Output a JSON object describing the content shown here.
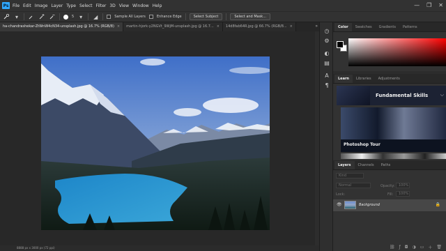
{
  "menu": [
    "File",
    "Edit",
    "Image",
    "Layer",
    "Type",
    "Select",
    "Filter",
    "3D",
    "View",
    "Window",
    "Help"
  ],
  "logo": "Ps",
  "window_controls": [
    "—",
    "❐",
    "✕"
  ],
  "options": {
    "brush_size": "5",
    "sample_all_layers": "Sample All Layers",
    "enhance_edge": "Enhance Edge",
    "select_subject": "Select Subject",
    "select_and_mask": "Select and Mask..."
  },
  "tabs": [
    {
      "label": "ha-chandrashekar-ZtWnW4cN34-unsplash.jpg @ 16.7% (RGB/8)",
      "active": true
    },
    {
      "label": "martin-hjork-y2NGVt_9WjM-unsplash.jpg @ 16.7...",
      "active": false
    },
    {
      "label": "14d8fab64R.jpg @ 66.7% (RGB/8...",
      "active": false
    }
  ],
  "tab_overflow": "»",
  "status": "8888 px x 3000 px (72 ppi)",
  "color_panel": {
    "tabs": [
      "Color",
      "Swatches",
      "Gradients",
      "Patterns"
    ]
  },
  "learn_panel": {
    "tabs": [
      "Learn",
      "Libraries",
      "Adjustments"
    ],
    "section_title": "Fundamental Skills",
    "tour_label": "Photoshop Tour"
  },
  "layers_panel": {
    "tabs": [
      "Layers",
      "Channels",
      "Paths"
    ],
    "kind": "Kind",
    "blend_mode": "Normal",
    "opacity_label": "Opacity:",
    "opacity_value": "100%",
    "lock_label": "Lock:",
    "fill_label": "Fill:",
    "fill_value": "100%",
    "layer_name": "Background"
  },
  "colors": {
    "accent": "#31a8ff",
    "fg": "#000000",
    "bg": "#ffffff"
  }
}
